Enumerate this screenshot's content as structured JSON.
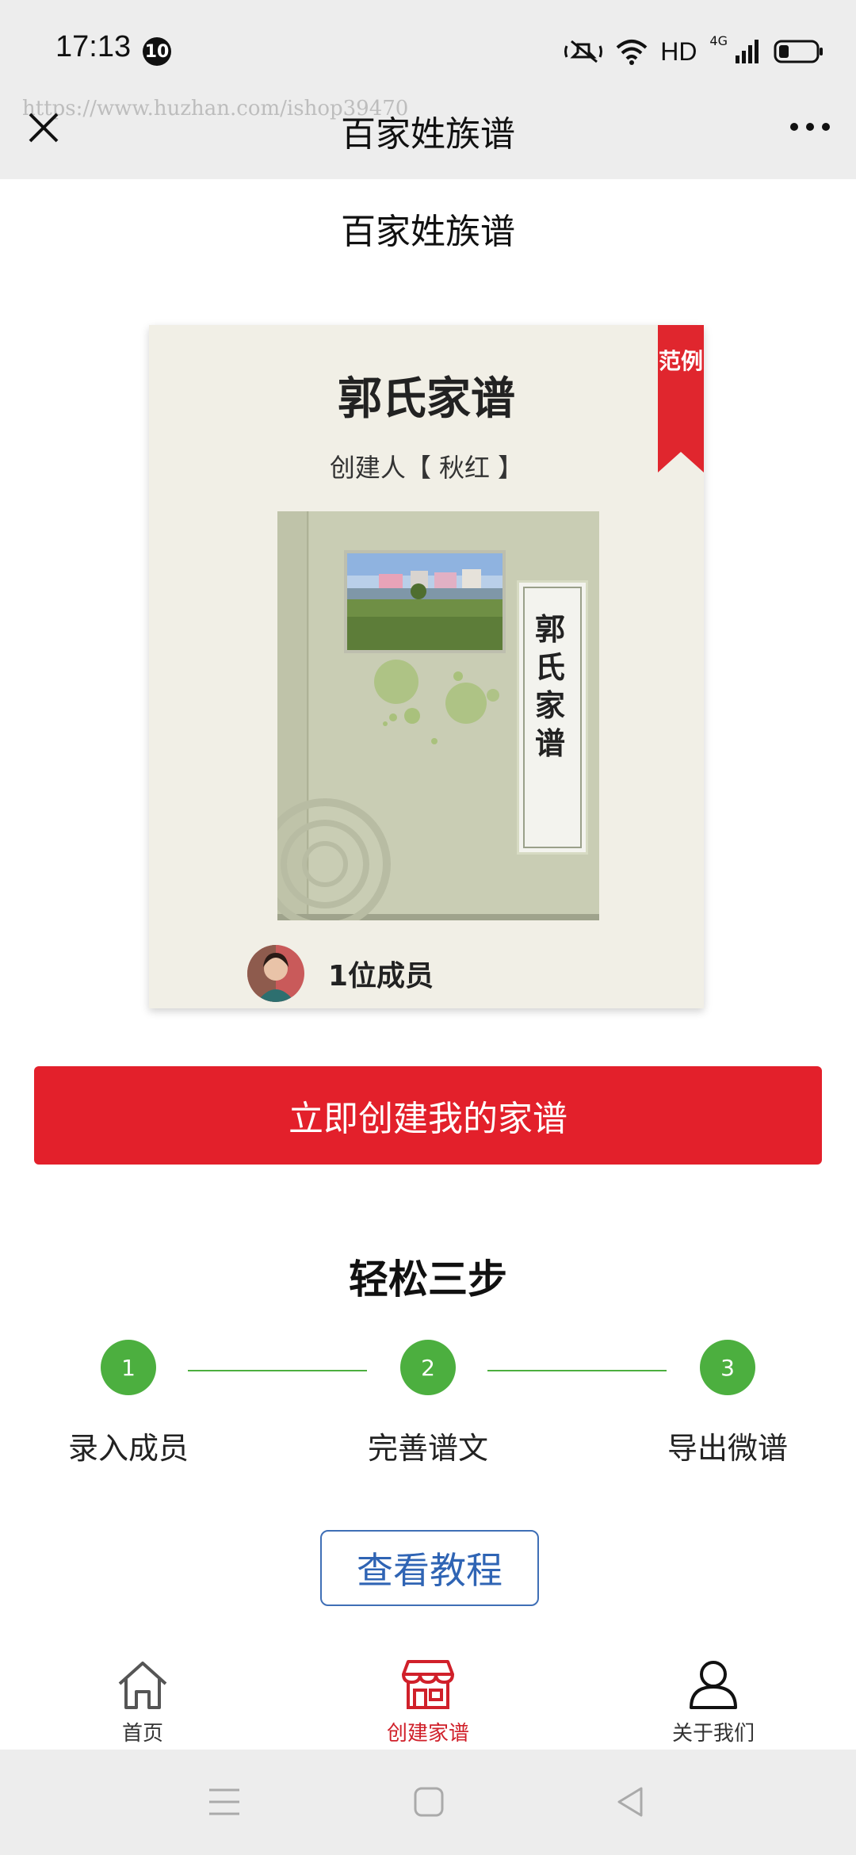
{
  "status_bar": {
    "time": "17:13",
    "notification_count": "10",
    "hd": "HD",
    "network": "4G",
    "icons": [
      "mute-icon",
      "wifi-icon",
      "signal-icon",
      "battery-icon"
    ]
  },
  "nav": {
    "title": "百家姓族谱",
    "watermark": "https://www.huzhan.com/ishop39470",
    "icons": [
      "close-icon",
      "more-icon"
    ]
  },
  "page": {
    "title": "百家姓族谱"
  },
  "card": {
    "ribbon": "范例",
    "title": "郭氏家谱",
    "creator": "创建人【 秋红 】",
    "book_label": "郭氏家谱",
    "member_count": "1位成员"
  },
  "cta": {
    "label": "立即创建我的家谱"
  },
  "steps": {
    "title": "轻松三步",
    "items": [
      {
        "number": "1",
        "label": "录入成员"
      },
      {
        "number": "2",
        "label": "完善谱文"
      },
      {
        "number": "3",
        "label": "导出微谱"
      }
    ]
  },
  "tutorial": {
    "label": "查看教程"
  },
  "tabs": [
    {
      "label": "首页",
      "icon": "home-icon",
      "active": false
    },
    {
      "label": "创建家谱",
      "icon": "store-icon",
      "active": true
    },
    {
      "label": "关于我们",
      "icon": "user-icon",
      "active": false
    }
  ],
  "colors": {
    "accent_red": "#e3202b",
    "step_green": "#4caf3f",
    "tutorial_blue": "#2f64b4"
  }
}
